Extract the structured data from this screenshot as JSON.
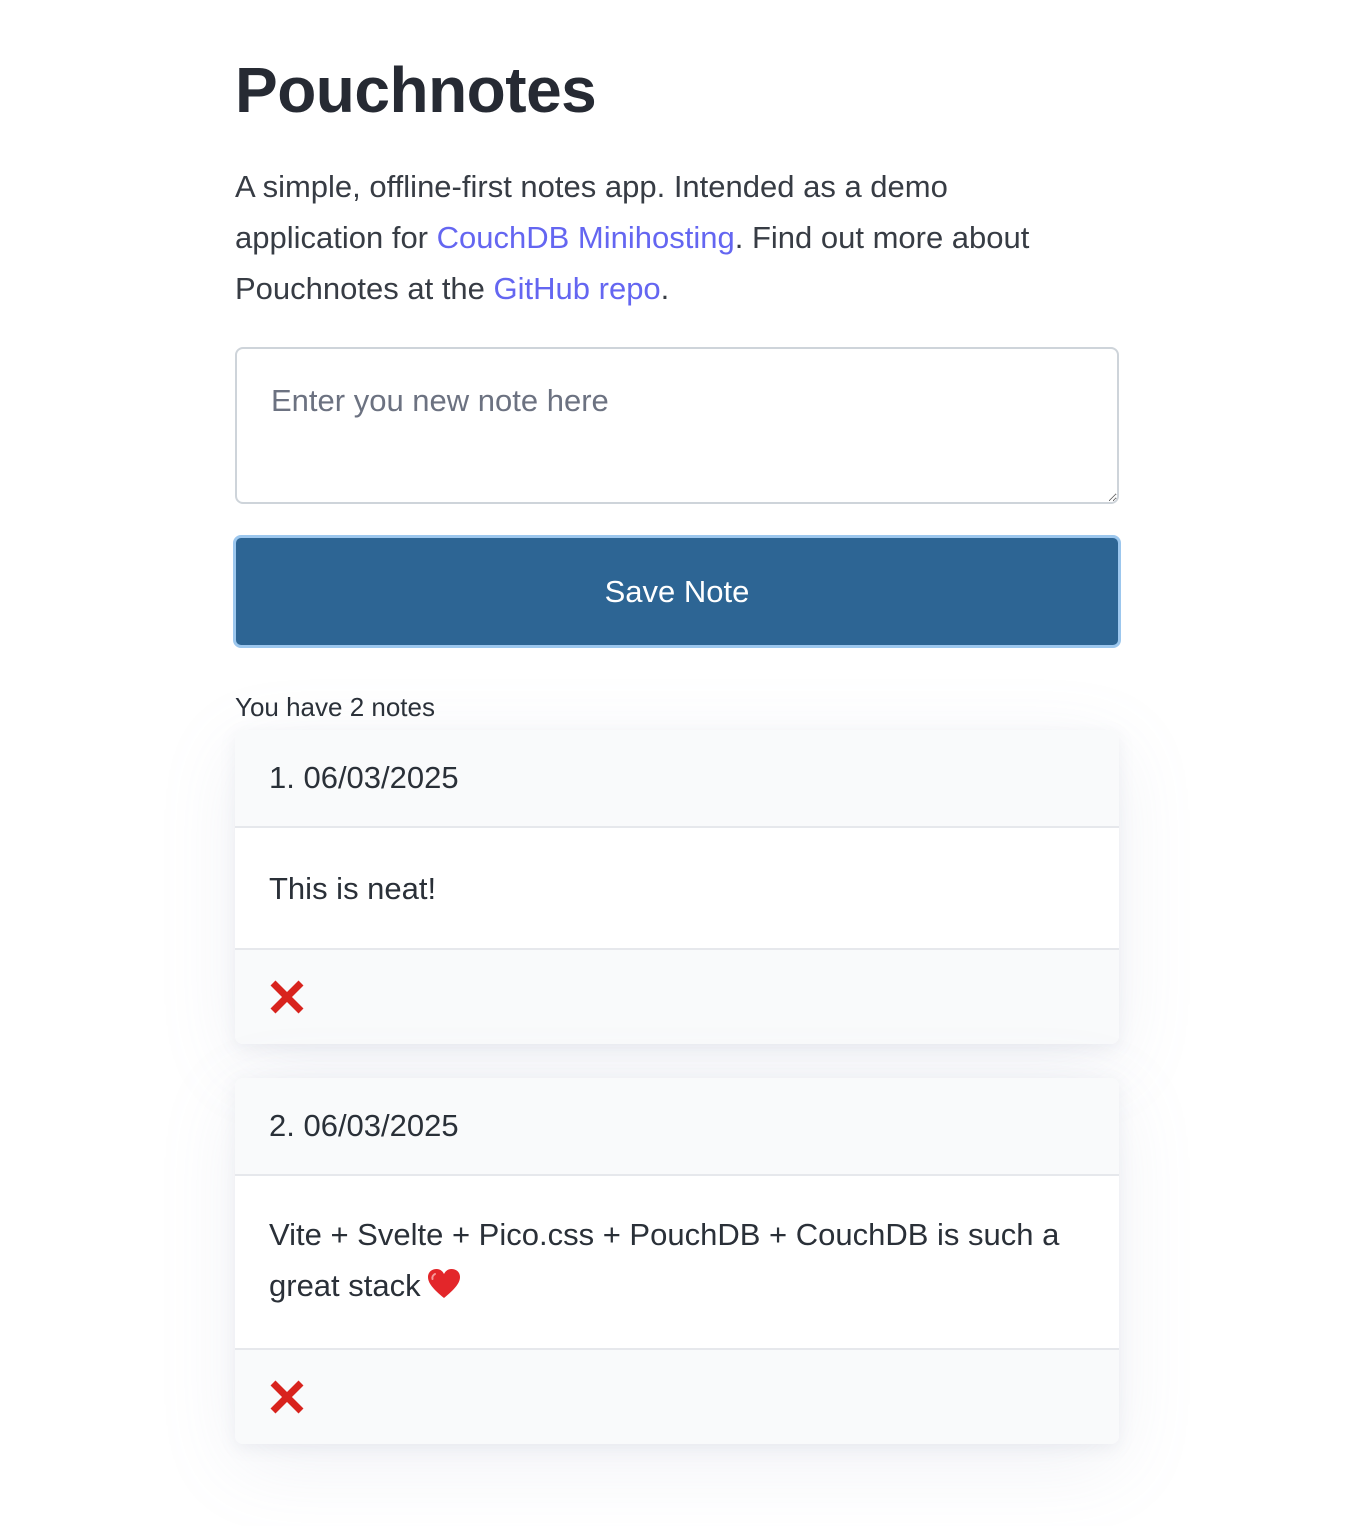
{
  "header": {
    "title": "Pouchnotes"
  },
  "intro": {
    "text_1": "A simple, offline-first notes app. Intended as a demo application for ",
    "link_1": "CouchDB Minihosting",
    "text_2": ". Find out more about Pouchnotes at the ",
    "link_2": "GitHub repo",
    "text_3": "."
  },
  "editor": {
    "placeholder": "Enter you new note here",
    "value": "",
    "save_label": "Save Note"
  },
  "notes": {
    "count_text": "You have 2 notes",
    "items": [
      {
        "header": "1. 06/03/2025",
        "body": "This is neat!",
        "delete_icon": "cross-mark-icon"
      },
      {
        "header": "2. 06/03/2025",
        "body": "Vite + Svelte + Pico.css + PouchDB + CouchDB is such a great stack",
        "body_emoji": "heart-icon",
        "delete_icon": "cross-mark-icon"
      }
    ]
  },
  "colors": {
    "link": "#6466f1",
    "button_bg": "#2d6594",
    "button_focus_ring": "#9cc7ee",
    "delete": "#d8231d",
    "heart": "#e3262a"
  }
}
